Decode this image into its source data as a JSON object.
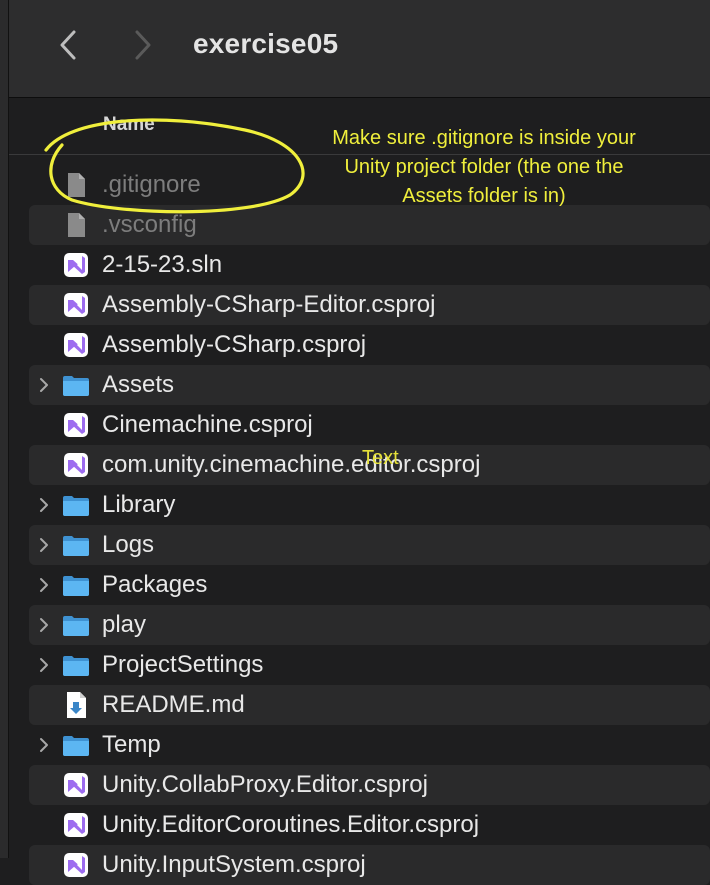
{
  "window": {
    "title": "exercise05",
    "back_icon": "chevron-left-icon",
    "forward_icon": "chevron-right-icon"
  },
  "columns": {
    "name_label": "Name"
  },
  "files": [
    {
      "name": ".gitignore",
      "kind": "doc",
      "folder": false,
      "dim": true
    },
    {
      "name": ".vsconfig",
      "kind": "doc",
      "folder": false,
      "dim": true
    },
    {
      "name": "2-15-23.sln",
      "kind": "vs",
      "folder": false,
      "dim": false
    },
    {
      "name": "Assembly-CSharp-Editor.csproj",
      "kind": "vs",
      "folder": false,
      "dim": false
    },
    {
      "name": "Assembly-CSharp.csproj",
      "kind": "vs",
      "folder": false,
      "dim": false
    },
    {
      "name": "Assets",
      "kind": "folder",
      "folder": true,
      "dim": false
    },
    {
      "name": "Cinemachine.csproj",
      "kind": "vs",
      "folder": false,
      "dim": false
    },
    {
      "name": "com.unity.cinemachine.editor.csproj",
      "kind": "vs",
      "folder": false,
      "dim": false
    },
    {
      "name": "Library",
      "kind": "folder",
      "folder": true,
      "dim": false
    },
    {
      "name": "Logs",
      "kind": "folder",
      "folder": true,
      "dim": false
    },
    {
      "name": "Packages",
      "kind": "folder",
      "folder": true,
      "dim": false
    },
    {
      "name": "play",
      "kind": "folder",
      "folder": true,
      "dim": false
    },
    {
      "name": "ProjectSettings",
      "kind": "folder",
      "folder": true,
      "dim": false
    },
    {
      "name": "README.md",
      "kind": "md",
      "folder": false,
      "dim": false
    },
    {
      "name": "Temp",
      "kind": "folder",
      "folder": true,
      "dim": false
    },
    {
      "name": "Unity.CollabProxy.Editor.csproj",
      "kind": "vs",
      "folder": false,
      "dim": false
    },
    {
      "name": "Unity.EditorCoroutines.Editor.csproj",
      "kind": "vs",
      "folder": false,
      "dim": false
    },
    {
      "name": "Unity.InputSystem.csproj",
      "kind": "vs",
      "folder": false,
      "dim": false
    }
  ],
  "annotation": {
    "note": "Make sure .gitignore is inside your Unity project folder (the one the Assets folder is in)",
    "floating_text": "Text",
    "color": "#f0ef3c"
  },
  "colors": {
    "folder": "#5cb6f2",
    "vs_purple": "#9d6cf0",
    "selection_alt_row": "#2a2a2b"
  }
}
